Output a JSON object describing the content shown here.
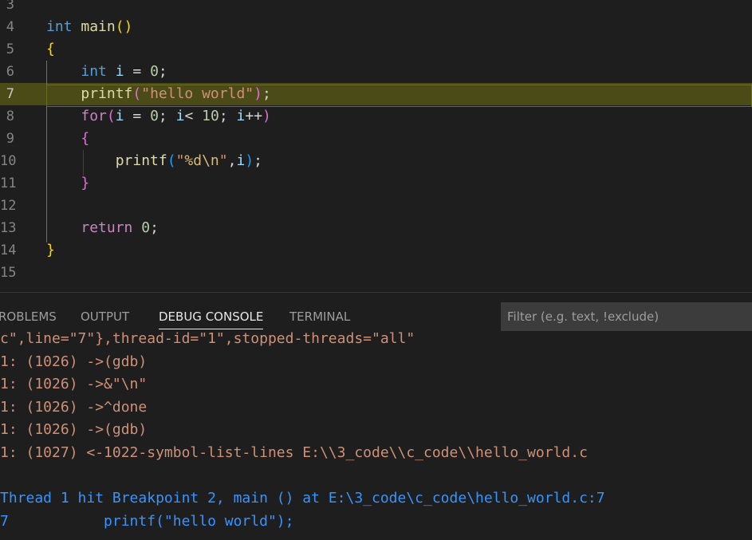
{
  "editor": {
    "lines": [
      {
        "num": "3",
        "indent": "",
        "tokens": []
      },
      {
        "num": "4",
        "indent": "",
        "tokens": [
          {
            "t": "int",
            "c": "kw"
          },
          {
            "t": " ",
            "c": ""
          },
          {
            "t": "main",
            "c": "fn"
          },
          {
            "t": "()",
            "c": "br1"
          }
        ]
      },
      {
        "num": "5",
        "indent": "",
        "tokens": [
          {
            "t": "{",
            "c": "br1"
          }
        ]
      },
      {
        "num": "6",
        "indent": "    ",
        "tokens": [
          {
            "t": "int",
            "c": "kw"
          },
          {
            "t": " ",
            "c": ""
          },
          {
            "t": "i",
            "c": "var"
          },
          {
            "t": " = ",
            "c": ""
          },
          {
            "t": "0",
            "c": "num"
          },
          {
            "t": ";",
            "c": ""
          }
        ]
      },
      {
        "num": "7",
        "indent": "    ",
        "tokens": [
          {
            "t": "printf",
            "c": "fn"
          },
          {
            "t": "(",
            "c": "br2"
          },
          {
            "t": "\"hello world\"",
            "c": "str"
          },
          {
            "t": ")",
            "c": "br2"
          },
          {
            "t": ";",
            "c": ""
          }
        ]
      },
      {
        "num": "8",
        "indent": "    ",
        "tokens": [
          {
            "t": "for",
            "c": "ctl"
          },
          {
            "t": "(",
            "c": "br2"
          },
          {
            "t": "i",
            "c": "var"
          },
          {
            "t": " = ",
            "c": ""
          },
          {
            "t": "0",
            "c": "num"
          },
          {
            "t": "; ",
            "c": ""
          },
          {
            "t": "i",
            "c": "var"
          },
          {
            "t": "< ",
            "c": ""
          },
          {
            "t": "10",
            "c": "num"
          },
          {
            "t": "; ",
            "c": ""
          },
          {
            "t": "i",
            "c": "var"
          },
          {
            "t": "++",
            "c": ""
          },
          {
            "t": ")",
            "c": "br2"
          }
        ]
      },
      {
        "num": "9",
        "indent": "    ",
        "tokens": [
          {
            "t": "{",
            "c": "br2"
          }
        ]
      },
      {
        "num": "10",
        "indent": "        ",
        "tokens": [
          {
            "t": "printf",
            "c": "fn"
          },
          {
            "t": "(",
            "c": "br3"
          },
          {
            "t": "\"",
            "c": "str"
          },
          {
            "t": "%d\\n",
            "c": "esc"
          },
          {
            "t": "\"",
            "c": "str"
          },
          {
            "t": ",",
            "c": ""
          },
          {
            "t": "i",
            "c": "var"
          },
          {
            "t": ")",
            "c": "br3"
          },
          {
            "t": ";",
            "c": ""
          }
        ]
      },
      {
        "num": "11",
        "indent": "    ",
        "tokens": [
          {
            "t": "}",
            "c": "br2"
          }
        ]
      },
      {
        "num": "12",
        "indent": "",
        "tokens": []
      },
      {
        "num": "13",
        "indent": "    ",
        "tokens": [
          {
            "t": "return",
            "c": "ctl"
          },
          {
            "t": " ",
            "c": ""
          },
          {
            "t": "0",
            "c": "num"
          },
          {
            "t": ";",
            "c": ""
          }
        ]
      },
      {
        "num": "14",
        "indent": "",
        "tokens": [
          {
            "t": "}",
            "c": "br1"
          }
        ]
      },
      {
        "num": "15",
        "indent": "",
        "tokens": []
      }
    ],
    "current_line": "7"
  },
  "panel": {
    "tabs": [
      {
        "label": "ROBLEMS",
        "active": false
      },
      {
        "label": "OUTPUT",
        "active": false
      },
      {
        "label": "DEBUG CONSOLE",
        "active": true
      },
      {
        "label": "TERMINAL",
        "active": false
      }
    ],
    "filter_placeholder": "Filter (e.g. text, !exclude)"
  },
  "console": {
    "lines": [
      {
        "text": "c\",line=\"7\"},thread-id=\"1\",stopped-threads=\"all\"",
        "color": "orange"
      },
      {
        "text": "1: (1026) ->(gdb)",
        "color": "orange"
      },
      {
        "text": "1: (1026) ->&\"\\n\"",
        "color": "orange"
      },
      {
        "text": "1: (1026) ->^done",
        "color": "orange"
      },
      {
        "text": "1: (1026) ->(gdb)",
        "color": "orange"
      },
      {
        "text": "1: (1027) <-1022-symbol-list-lines E:\\\\3_code\\\\c_code\\\\hello_world.c",
        "color": "orange"
      },
      {
        "text": "",
        "color": "orange"
      },
      {
        "text": "Thread 1 hit Breakpoint 2, main () at E:\\3_code\\c_code\\hello_world.c:7",
        "color": "blue"
      },
      {
        "text": "7           printf(\"hello world\");",
        "color": "blue"
      }
    ]
  },
  "colors": {
    "editor_bg": "#1e1e1e",
    "current_line_bg": "#4b4b18",
    "console_orange": "#ce9178",
    "console_blue": "#3794ff"
  }
}
